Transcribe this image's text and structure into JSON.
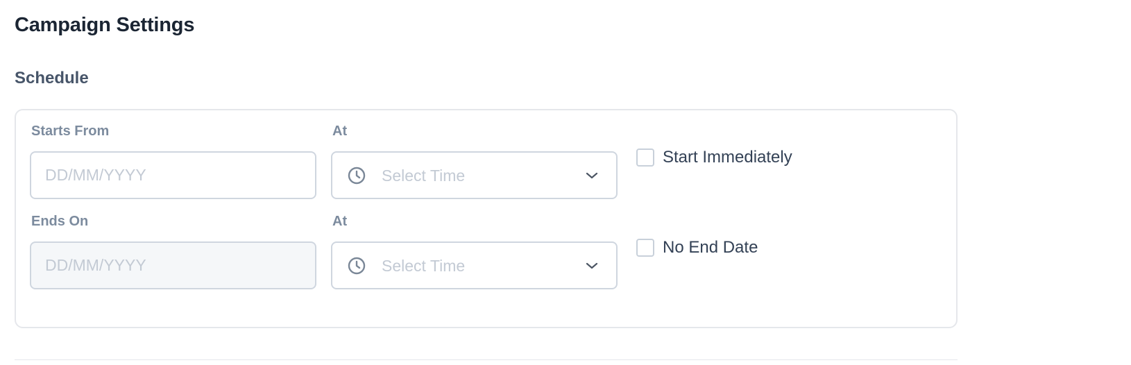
{
  "page": {
    "title": "Campaign Settings",
    "section_title": "Schedule"
  },
  "schedule": {
    "start": {
      "date_label": "Starts From",
      "date_placeholder": "DD/MM/YYYY",
      "time_label": "At",
      "time_placeholder": "Select Time",
      "checkbox_label": "Start Immediately",
      "checkbox_checked": false
    },
    "end": {
      "date_label": "Ends On",
      "date_placeholder": "DD/MM/YYYY",
      "date_disabled": true,
      "time_label": "At",
      "time_placeholder": "Select Time",
      "checkbox_label": "No End Date",
      "checkbox_checked": false
    }
  },
  "icons": {
    "time_select": "clock-icon",
    "dropdown": "chevron-down-icon"
  },
  "colors": {
    "heading": "#1b2533",
    "section_heading": "#475569",
    "field_label": "#7c8b9e",
    "placeholder": "#c3cad4",
    "border": "#cfd6df",
    "card_border": "#e5e7eb",
    "icon": "#7a8797"
  }
}
